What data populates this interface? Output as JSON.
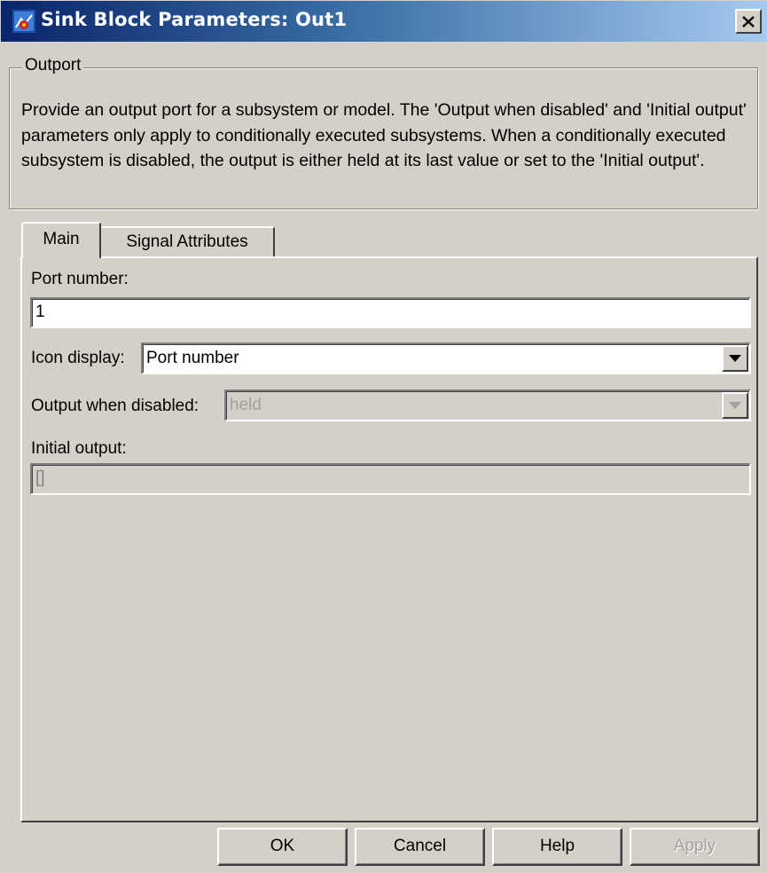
{
  "window": {
    "title": "Sink Block Parameters: Out1",
    "icon": "simulink-block-icon",
    "close_icon": "close-icon"
  },
  "groupbox": {
    "legend": "Outport",
    "description": "Provide an output port for a subsystem or model.  The 'Output when disabled' and 'Initial output' parameters only apply to conditionally executed subsystems. When a conditionally executed subsystem is disabled, the output is either held at its last value or set to the 'Initial output'."
  },
  "tabs": [
    {
      "label": "Main",
      "selected": true
    },
    {
      "label": "Signal Attributes",
      "selected": false
    }
  ],
  "main": {
    "port_number": {
      "label": "Port number:",
      "value": "1"
    },
    "icon_display": {
      "label": "Icon display:",
      "value": "Port number"
    },
    "output_when_disabled": {
      "label": "Output when disabled:",
      "value": "held",
      "enabled": false
    },
    "initial_output": {
      "label": "Initial output:",
      "value": "[]",
      "enabled": false
    }
  },
  "buttons": {
    "ok": "OK",
    "cancel": "Cancel",
    "help": "Help",
    "apply": "Apply"
  },
  "colors": {
    "face": "#d4d0c8",
    "title_start": "#0a246a",
    "title_end": "#a6caf0",
    "disabled_text": "#a0a0a0"
  }
}
